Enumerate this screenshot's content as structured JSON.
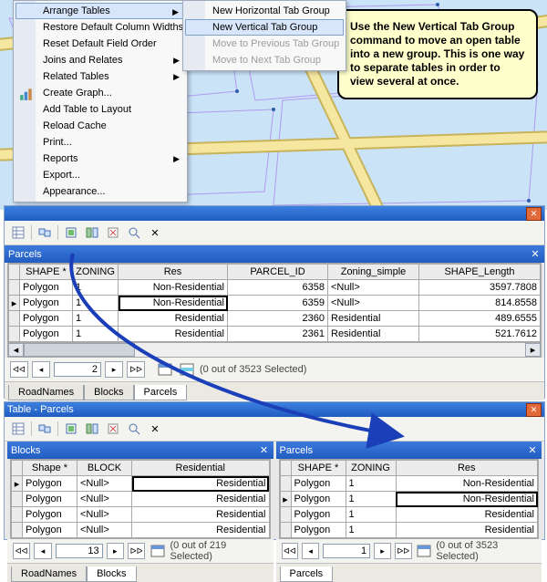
{
  "menus": {
    "main": [
      {
        "label": "Arrange Tables",
        "sel": true,
        "hasSub": true
      },
      {
        "label": "Restore Default Column Widths"
      },
      {
        "label": "Reset Default Field Order"
      },
      {
        "label": "Joins and Relates",
        "hasSub": true
      },
      {
        "label": "Related Tables",
        "hasSub": true
      },
      {
        "label": "Create Graph...",
        "icon": "bar"
      },
      {
        "label": "Add Table to Layout"
      },
      {
        "label": "Reload Cache"
      },
      {
        "label": "Print..."
      },
      {
        "label": "Reports",
        "hasSub": true
      },
      {
        "label": "Export..."
      },
      {
        "label": "Appearance..."
      }
    ],
    "sub": [
      {
        "label": "New Horizontal Tab Group"
      },
      {
        "label": "New Vertical Tab Group",
        "sel": true
      },
      {
        "label": "Move to Previous Tab Group",
        "disabled": true
      },
      {
        "label": "Move to Next Tab Group",
        "disabled": true
      }
    ]
  },
  "tip_text": "Use the New Vertical Tab Group command to move an open table into a new group.  This is one way to separate tables in order to view several at once.",
  "top_window": {
    "tab_title": "Parcels",
    "columns": [
      "SHAPE *",
      "ZONING",
      "Res",
      "PARCEL_ID",
      "Zoning_simple",
      "SHAPE_Length"
    ],
    "rows": [
      [
        "Polygon",
        "1",
        "Non-Residential",
        "6358",
        "<Null>",
        "3597.7808"
      ],
      [
        "Polygon",
        "1",
        "Non-Residential",
        "6359",
        "<Null>",
        "814.8558"
      ],
      [
        "Polygon",
        "1",
        "Residential",
        "2360",
        "Residential",
        "489.6555"
      ],
      [
        "Polygon",
        "1",
        "Residential",
        "2361",
        "Residential",
        "521.7612"
      ]
    ],
    "current_record": "2",
    "total": "3523",
    "sel_text": "(0 out of 3523 Selected)",
    "tabs": [
      "RoadNames",
      "Blocks",
      "Parcels"
    ],
    "active_tab": 2
  },
  "bot_window": {
    "title": "Table - Parcels",
    "left": {
      "tab_title": "Blocks",
      "columns": [
        "Shape *",
        "BLOCK",
        "Residential"
      ],
      "rows": [
        [
          "Polygon",
          "<Null>",
          "Residential"
        ],
        [
          "Polygon",
          "<Null>",
          "Residential"
        ],
        [
          "Polygon",
          "<Null>",
          "Residential"
        ],
        [
          "Polygon",
          "<Null>",
          "Residential"
        ]
      ],
      "current_record": "13",
      "sel_text": "(0 out of 219 Selected)",
      "tabs": [
        "RoadNames",
        "Blocks"
      ],
      "active_tab": 1
    },
    "right": {
      "tab_title": "Parcels",
      "columns": [
        "SHAPE *",
        "ZONING",
        "Res"
      ],
      "rows": [
        [
          "Polygon",
          "1",
          "Non-Residential"
        ],
        [
          "Polygon",
          "1",
          "Non-Residential"
        ],
        [
          "Polygon",
          "1",
          "Residential"
        ],
        [
          "Polygon",
          "1",
          "Residential"
        ]
      ],
      "current_record": "1",
      "sel_text": "(0 out of 3523 Selected)",
      "tabs": [
        "Parcels"
      ],
      "active_tab": 0
    }
  }
}
